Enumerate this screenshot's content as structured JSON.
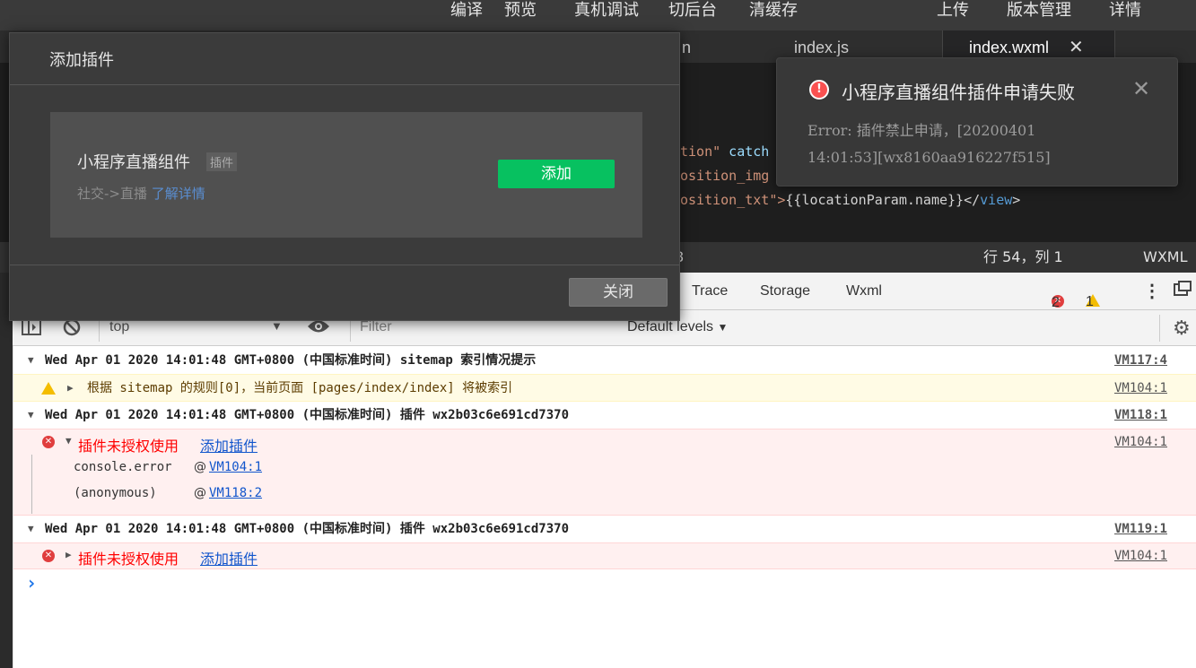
{
  "toolbar": {
    "compile": "编译",
    "preview": "预览",
    "device_debug": "真机调试",
    "background": "切后台",
    "clear_cache": "清缓存",
    "upload": "上传",
    "version_mgmt": "版本管理",
    "details": "详情"
  },
  "editor_tabs": {
    "partial_tab": "n",
    "tab1": "index.js",
    "tab2": "index.wxml",
    "tab2_close": "✕"
  },
  "code": {
    "line1_attr": "tion\"",
    "line1_kw": " catch",
    "line2_attr": "osition_img",
    "line3_attr": "osition_txt\">",
    "line3_text": "{{locationParam.name}}",
    "line3_close": "</",
    "line3_tag": "view",
    "line3_end": ">"
  },
  "statusbar": {
    "partial": "8",
    "position": "行 54，列 1",
    "language": "WXML"
  },
  "devtools": {
    "tabs": [
      "Trace",
      "Storage",
      "Wxml"
    ],
    "error_count": "2",
    "warning_count": "1",
    "context": "top",
    "filter_placeholder": "Filter",
    "levels": "Default levels"
  },
  "console": {
    "group1": "Wed Apr 01 2020 14:01:48 GMT+0800 (中国标准时间) sitemap 索引情况提示",
    "group1_src": "VM117:4",
    "warn1": "根据 sitemap 的规则[0]，当前页面 [pages/index/index] 将被索引",
    "warn1_src": "VM104:1",
    "group2": "Wed Apr 01 2020 14:01:48 GMT+0800 (中国标准时间) 插件 wx2b03c6e691cd7370",
    "group2_src": "VM118:1",
    "err1_text": "插件未授权使用",
    "err1_link": "添加插件",
    "err1_src": "VM104:1",
    "stack1_fn": "console.error",
    "stack1_at": "@",
    "stack1_link": "VM104:1",
    "stack2_fn": "(anonymous)",
    "stack2_at": "@",
    "stack2_link": "VM118:2",
    "group3": "Wed Apr 01 2020 14:01:48 GMT+0800 (中国标准时间) 插件 wx2b03c6e691cd7370",
    "group3_src": "VM119:1",
    "err2_text": "插件未授权使用",
    "err2_link": "添加插件",
    "err2_src": "VM104:1",
    "prompt": "›"
  },
  "modal": {
    "title": "添加插件",
    "plugin_name": "小程序直播组件",
    "plugin_tag": "插件",
    "plugin_category": "社交->直播",
    "plugin_more": "了解详情",
    "add_button": "添加",
    "close_button": "关闭"
  },
  "toast": {
    "title": "小程序直播组件插件申请失败",
    "message": "Error: 插件禁止申请，[20200401 14:01:53][wx8160aa916227f515]",
    "close": "✕"
  },
  "colors": {
    "accent_green": "#07c160",
    "error_red": "#fa5151",
    "warning_yellow": "#f4bd00",
    "link_blue": "#5a8ed1"
  }
}
